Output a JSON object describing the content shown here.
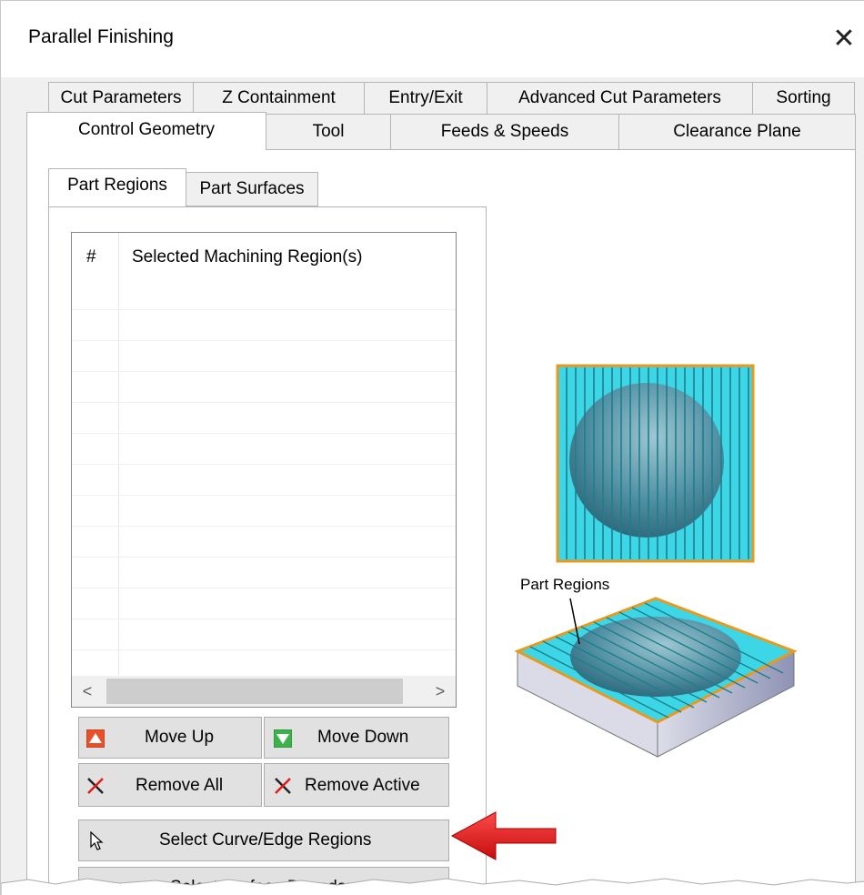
{
  "window": {
    "title": "Parallel Finishing",
    "close_glyph": "✕"
  },
  "tabs_row1": [
    "Cut Parameters",
    "Z Containment",
    "Entry/Exit",
    "Advanced Cut Parameters",
    "Sorting"
  ],
  "tabs_row2": [
    "Control Geometry",
    "Tool",
    "Feeds & Speeds",
    "Clearance Plane"
  ],
  "active_tab": "Control Geometry",
  "subtabs": [
    "Part Regions",
    "Part Surfaces"
  ],
  "active_subtab": "Part Regions",
  "region_list": {
    "columns": [
      "#",
      "Selected Machining Region(s)"
    ],
    "rows": [],
    "scroll_left": "<",
    "scroll_right": ">"
  },
  "buttons": {
    "move_up": "Move Up",
    "move_down": "Move Down",
    "remove_all": "Remove All",
    "remove_active": "Remove Active",
    "select_curve": "Select Curve/Edge Regions",
    "select_surface": "Select Surface Boundary"
  },
  "illustration": {
    "label": "Part Regions"
  },
  "colors": {
    "accent_cyan": "#3dd6e6",
    "boundary_orange": "#e89a1e",
    "pointer_red": "#e01b1b",
    "up_icon": "#e8502a",
    "down_icon": "#3cb34a"
  },
  "icons": {
    "move_up": "triangle-up-icon",
    "move_down": "triangle-down-icon",
    "remove": "x-icon",
    "select": "cursor-arrow-icon",
    "close": "close-icon"
  }
}
